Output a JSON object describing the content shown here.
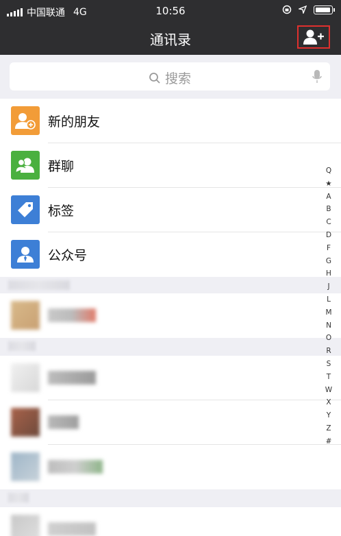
{
  "status_bar": {
    "carrier": "中国联通",
    "network": "4G",
    "time": "10:56"
  },
  "nav": {
    "title": "通讯录",
    "add_contact_icon": "add-user-icon"
  },
  "search": {
    "placeholder": "搜索",
    "icon": "search-icon",
    "mic_icon": "microphone-icon"
  },
  "functions": [
    {
      "label": "新的朋友",
      "icon": "new-friend-icon",
      "color": "#f29c38"
    },
    {
      "label": "群聊",
      "icon": "group-chat-icon",
      "color": "#4ab03f"
    },
    {
      "label": "标签",
      "icon": "tag-icon",
      "color": "#3d7fd6"
    },
    {
      "label": "公众号",
      "icon": "official-account-icon",
      "color": "#3d7fd6"
    }
  ],
  "index_letters": [
    "Q",
    "★",
    "A",
    "B",
    "C",
    "D",
    "F",
    "G",
    "H",
    "J",
    "L",
    "M",
    "N",
    "O",
    "R",
    "S",
    "T",
    "W",
    "X",
    "Y",
    "Z",
    "#"
  ],
  "colors": {
    "nav_bg": "#2e2e30",
    "highlight_border": "#e0302e",
    "page_bg": "#efeff4"
  }
}
